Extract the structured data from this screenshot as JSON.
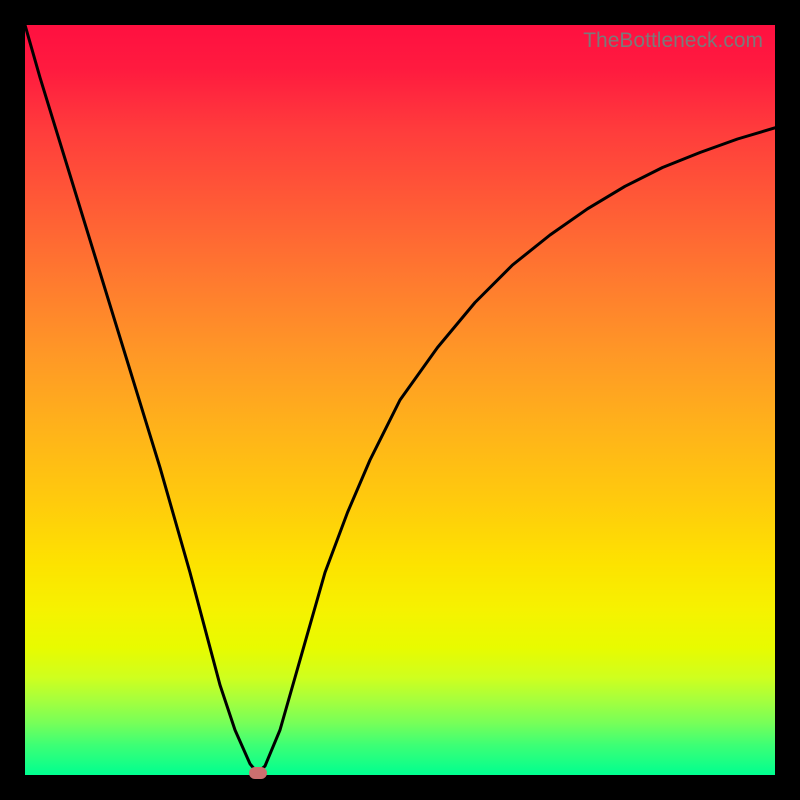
{
  "watermark": "TheBottleneck.com",
  "chart_data": {
    "type": "line",
    "title": "",
    "xlabel": "",
    "ylabel": "",
    "xlim": [
      0,
      100
    ],
    "ylim": [
      0,
      100
    ],
    "series": [
      {
        "name": "bottleneck-curve",
        "x": [
          0,
          2,
          4,
          6,
          8,
          10,
          12,
          14,
          16,
          18,
          20,
          22,
          24,
          26,
          28,
          30,
          31,
          32,
          34,
          36,
          38,
          40,
          43,
          46,
          50,
          55,
          60,
          65,
          70,
          75,
          80,
          85,
          90,
          95,
          100
        ],
        "y": [
          100,
          93,
          86.5,
          80,
          73.5,
          67,
          60.5,
          54,
          47.5,
          41,
          34,
          27,
          19.5,
          12,
          6,
          1.5,
          0.3,
          1.2,
          6,
          13,
          20,
          27,
          35,
          42,
          50,
          57,
          63,
          68,
          72,
          75.5,
          78.5,
          81,
          83,
          84.8,
          86.3
        ]
      }
    ],
    "annotations": [
      {
        "name": "minimum-marker",
        "x": 31,
        "y": 0.3,
        "shape": "pill",
        "color": "#cc6f6f"
      }
    ],
    "gradient_stops": [
      {
        "pos": 0,
        "color": "#ff1040"
      },
      {
        "pos": 50,
        "color": "#ffb31a"
      },
      {
        "pos": 78,
        "color": "#f6f200"
      },
      {
        "pos": 100,
        "color": "#00ff90"
      }
    ]
  }
}
